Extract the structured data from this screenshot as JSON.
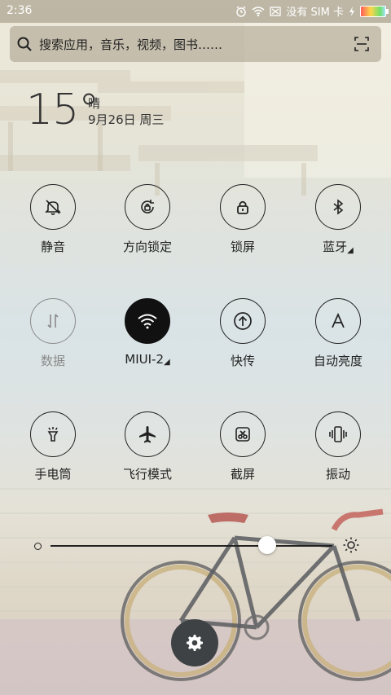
{
  "status_bar": {
    "time": "2:36",
    "carrier": "没有 SIM 卡"
  },
  "search": {
    "placeholder": "搜索应用，音乐，视频，图书……"
  },
  "weather": {
    "temperature": "15°",
    "condition": "晴",
    "date": "9月26日 周三"
  },
  "toggles": [
    {
      "label": "静音",
      "icon": "silent-bell-icon"
    },
    {
      "label": "方向锁定",
      "icon": "rotation-lock-icon"
    },
    {
      "label": "锁屏",
      "icon": "lock-icon"
    },
    {
      "label": "蓝牙",
      "icon": "bluetooth-icon"
    },
    {
      "label": "数据",
      "icon": "mobile-data-icon"
    },
    {
      "label": "MIUI-2",
      "icon": "wifi-icon"
    },
    {
      "label": "快传",
      "icon": "upload-icon"
    },
    {
      "label": "自动亮度",
      "icon": "auto-brightness-icon"
    },
    {
      "label": "手电筒",
      "icon": "flashlight-icon"
    },
    {
      "label": "飞行模式",
      "icon": "airplane-icon"
    },
    {
      "label": "截屏",
      "icon": "screenshot-icon"
    },
    {
      "label": "振动",
      "icon": "vibrate-icon"
    }
  ],
  "brightness": {
    "level": 0.77
  },
  "colors": {
    "active_toggle": "#111111",
    "inactive_label": "#8a8a8a"
  }
}
